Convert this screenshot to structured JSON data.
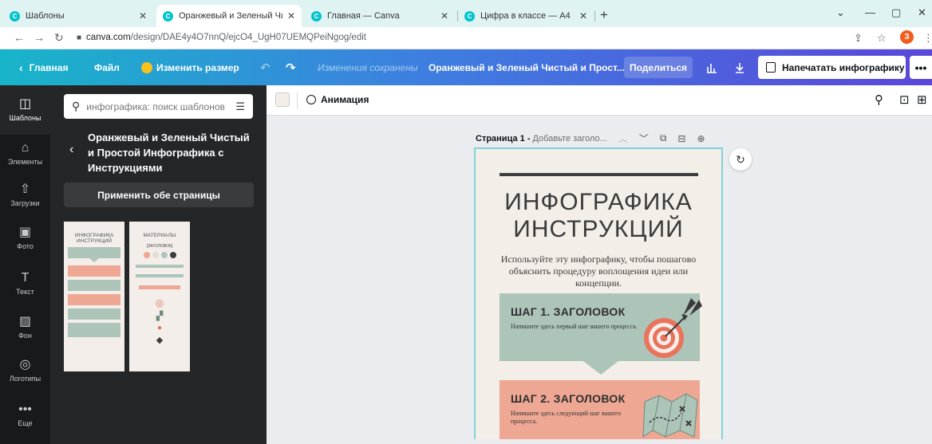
{
  "browser": {
    "tabs": [
      {
        "title": "Шаблоны",
        "favicon": "C",
        "active": false
      },
      {
        "title": "Оранжевый и Зеленый Чистый",
        "favicon": "C",
        "active": true
      },
      {
        "title": "Главная — Canva",
        "favicon": "C",
        "active": false
      },
      {
        "title": "Цифра в классе — А4",
        "favicon": "C",
        "active": false
      }
    ],
    "tab_close": "✕",
    "new_tab": "+",
    "url_host": "canva.com",
    "url_path": "/design/DAE4y4O7nnQ/ejcO4_UgH07UEMQPeiNgog/edit",
    "profile_initial": "З"
  },
  "toolbar": {
    "home": "Главная",
    "file": "Файл",
    "resize": "Изменить размер",
    "saved_status": "Изменения сохранены",
    "design_title": "Оранжевый и Зеленый Чистый и Прост...",
    "share": "Поделиться",
    "print": "Напечатать инфографику",
    "more": "•••"
  },
  "rail": {
    "items": [
      {
        "label": "Шаблоны",
        "icon": "template-icon",
        "glyph": "◫"
      },
      {
        "label": "Элементы",
        "icon": "elements-icon",
        "glyph": "⌂"
      },
      {
        "label": "Загрузки",
        "icon": "upload-icon",
        "glyph": "⇧"
      },
      {
        "label": "Фото",
        "icon": "photo-icon",
        "glyph": "▣"
      },
      {
        "label": "Текст",
        "icon": "text-icon",
        "glyph": "T"
      },
      {
        "label": "Фон",
        "icon": "background-icon",
        "glyph": "▨"
      },
      {
        "label": "Логотипы",
        "icon": "logo-icon",
        "glyph": "◎"
      },
      {
        "label": "Еще",
        "icon": "more-icon",
        "glyph": "•••"
      }
    ]
  },
  "panel": {
    "search_placeholder": "инфографика: поиск шаблонов",
    "template_title": "Оранжевый и Зеленый Чистый и Простой Инфографика с Инструкциями",
    "apply_button": "Применить обе страницы",
    "thumbs": [
      {
        "title": "ИНФОГРАФИКА ИНСТРУКЦИЙ"
      },
      {
        "title": "МАТЕРИАЛЫ",
        "sub": "[ЗАГОЛОВОК]"
      }
    ]
  },
  "editor": {
    "animation": "Анимация",
    "page_label": "Страница 1 -",
    "page_hint": "Добавьте заголо...",
    "swatch_color": "#f3eee8"
  },
  "infographic": {
    "title_line1": "ИНФОГРАФИКА",
    "title_line2": "ИНСТРУКЦИЙ",
    "description": "Используйте эту инфографику, чтобы пошагово объяснить процедуру воплощения идеи или концепции.",
    "steps": [
      {
        "heading": "ШАГ 1. ЗАГОЛОВОК",
        "text": "Напишите здесь первый шаг вашего процесса.",
        "color": "#adc4b8"
      },
      {
        "heading": "ШАГ 2. ЗАГОЛОВОК",
        "text": "Напишите здесь следующий шаг вашего процесса.",
        "color": "#eea793"
      }
    ]
  },
  "colors": {
    "accent_gradient_start": "#18b5c9",
    "accent_gradient_end": "#5a47d9",
    "sage": "#adc4b8",
    "salmon": "#eea793",
    "page_bg": "#f3eee8",
    "selection": "#7dd4d9"
  }
}
